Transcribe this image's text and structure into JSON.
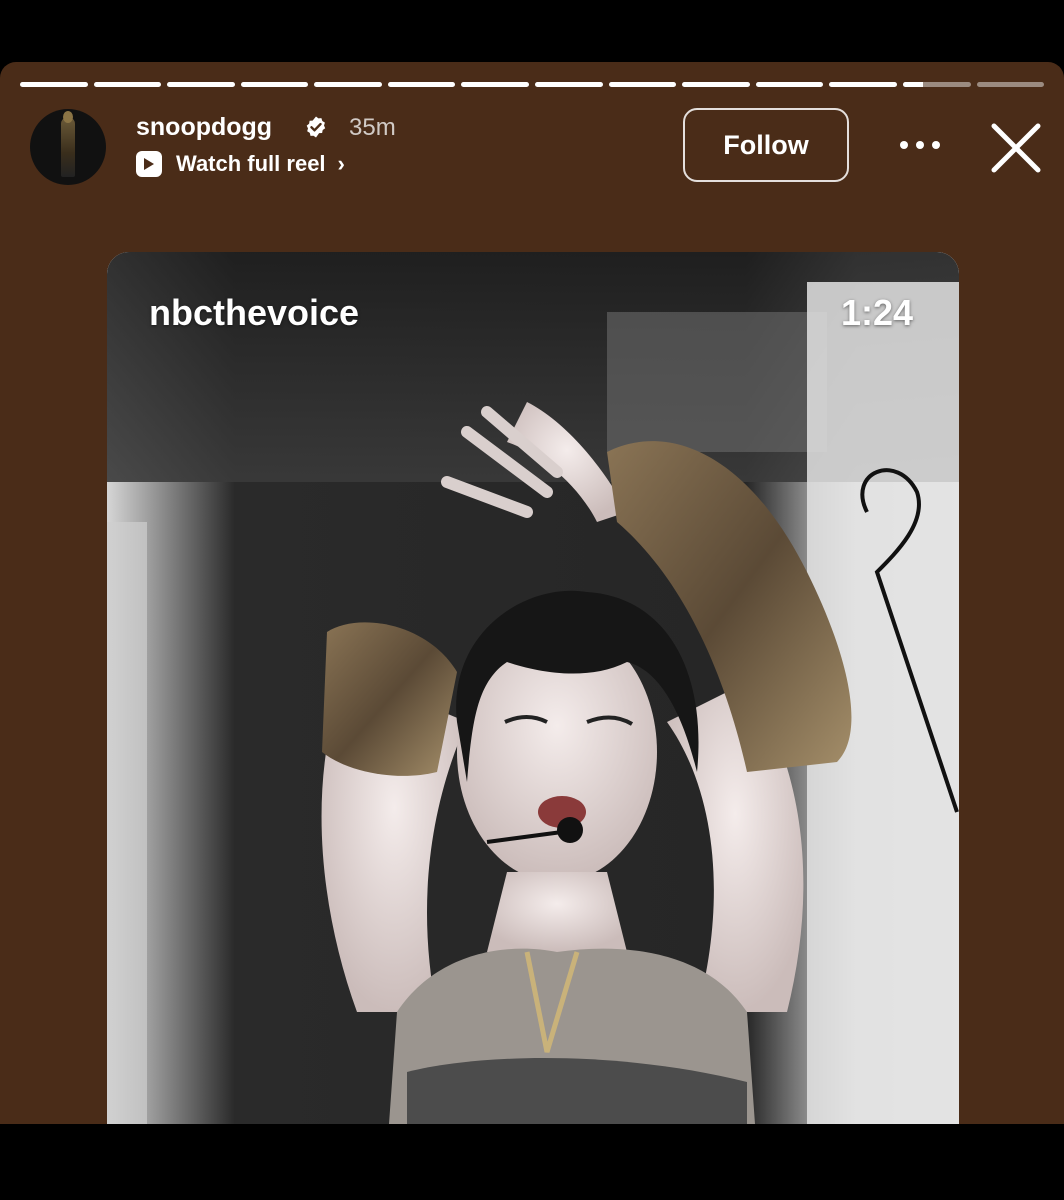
{
  "story": {
    "segments": [
      1,
      1,
      1,
      1,
      1,
      1,
      1,
      1,
      1,
      1,
      1,
      1,
      0.3,
      0
    ],
    "user": {
      "username": "snoopdogg",
      "verified": true,
      "time_ago": "35m",
      "reel_link_label": "Watch full reel",
      "chevron": "›"
    },
    "actions": {
      "follow_label": "Follow",
      "more_icon": "more-horizontal-icon",
      "close_icon": "close-icon"
    }
  },
  "reel_card": {
    "username": "nbcthevoice",
    "duration": "1:24"
  },
  "colors": {
    "story_background": "#4a2c18",
    "progress_fill": "#ffffff"
  }
}
